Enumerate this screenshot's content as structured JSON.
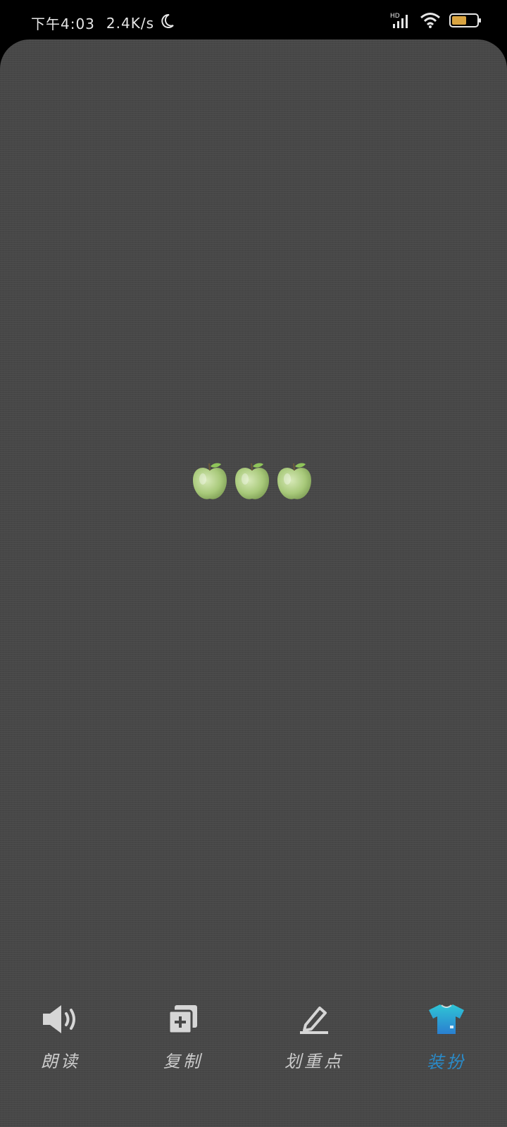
{
  "status_bar": {
    "time": "下午4:03",
    "network_speed": "2.4K/s",
    "icons": [
      "moon-icon",
      "hd-signal-icon",
      "wifi-icon",
      "battery-icon"
    ]
  },
  "reader": {
    "content_emoji": "🍏🍏🍏"
  },
  "toolbar": {
    "items": [
      {
        "label": "朗读",
        "icon": "speaker-icon",
        "active": false
      },
      {
        "label": "复制",
        "icon": "copy-icon",
        "active": false
      },
      {
        "label": "划重点",
        "icon": "highlight-pen-icon",
        "active": false
      },
      {
        "label": "装扮",
        "icon": "tshirt-icon",
        "active": true
      }
    ]
  },
  "colors": {
    "background": "#474747",
    "active_accent": "#2a8bc9",
    "apple_green": "#a8c97a"
  }
}
